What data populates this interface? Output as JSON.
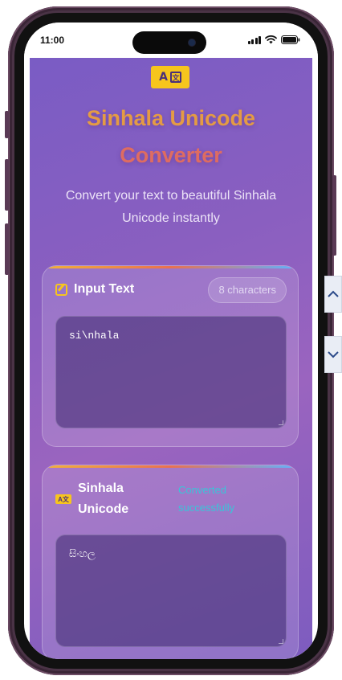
{
  "status_bar": {
    "time": "11:00"
  },
  "app": {
    "logo_glyph_a": "A",
    "logo_glyph_tr": "文",
    "title_line1": "Sinhala Unicode",
    "title_line2": "Converter",
    "subtitle": "Convert your text to beautiful Sinhala Unicode instantly"
  },
  "input_card": {
    "title": "Input Text",
    "char_count": "8 characters",
    "value": "si\\nhala"
  },
  "output_card": {
    "title": "Sinhala Unicode",
    "status": "Converted successfully",
    "value": "සිංහල"
  },
  "colors": {
    "accent_yellow": "#f7c51d",
    "title_orange": "#e49b44",
    "title_red": "#de6c61",
    "success_cyan": "#39c5d8",
    "background_purple": "#8a5fc0"
  },
  "icons": {
    "input_icon": "edit-icon",
    "output_icon": "translate-icon",
    "scroll_up": "chevron-up-icon",
    "scroll_down": "chevron-down-icon"
  }
}
